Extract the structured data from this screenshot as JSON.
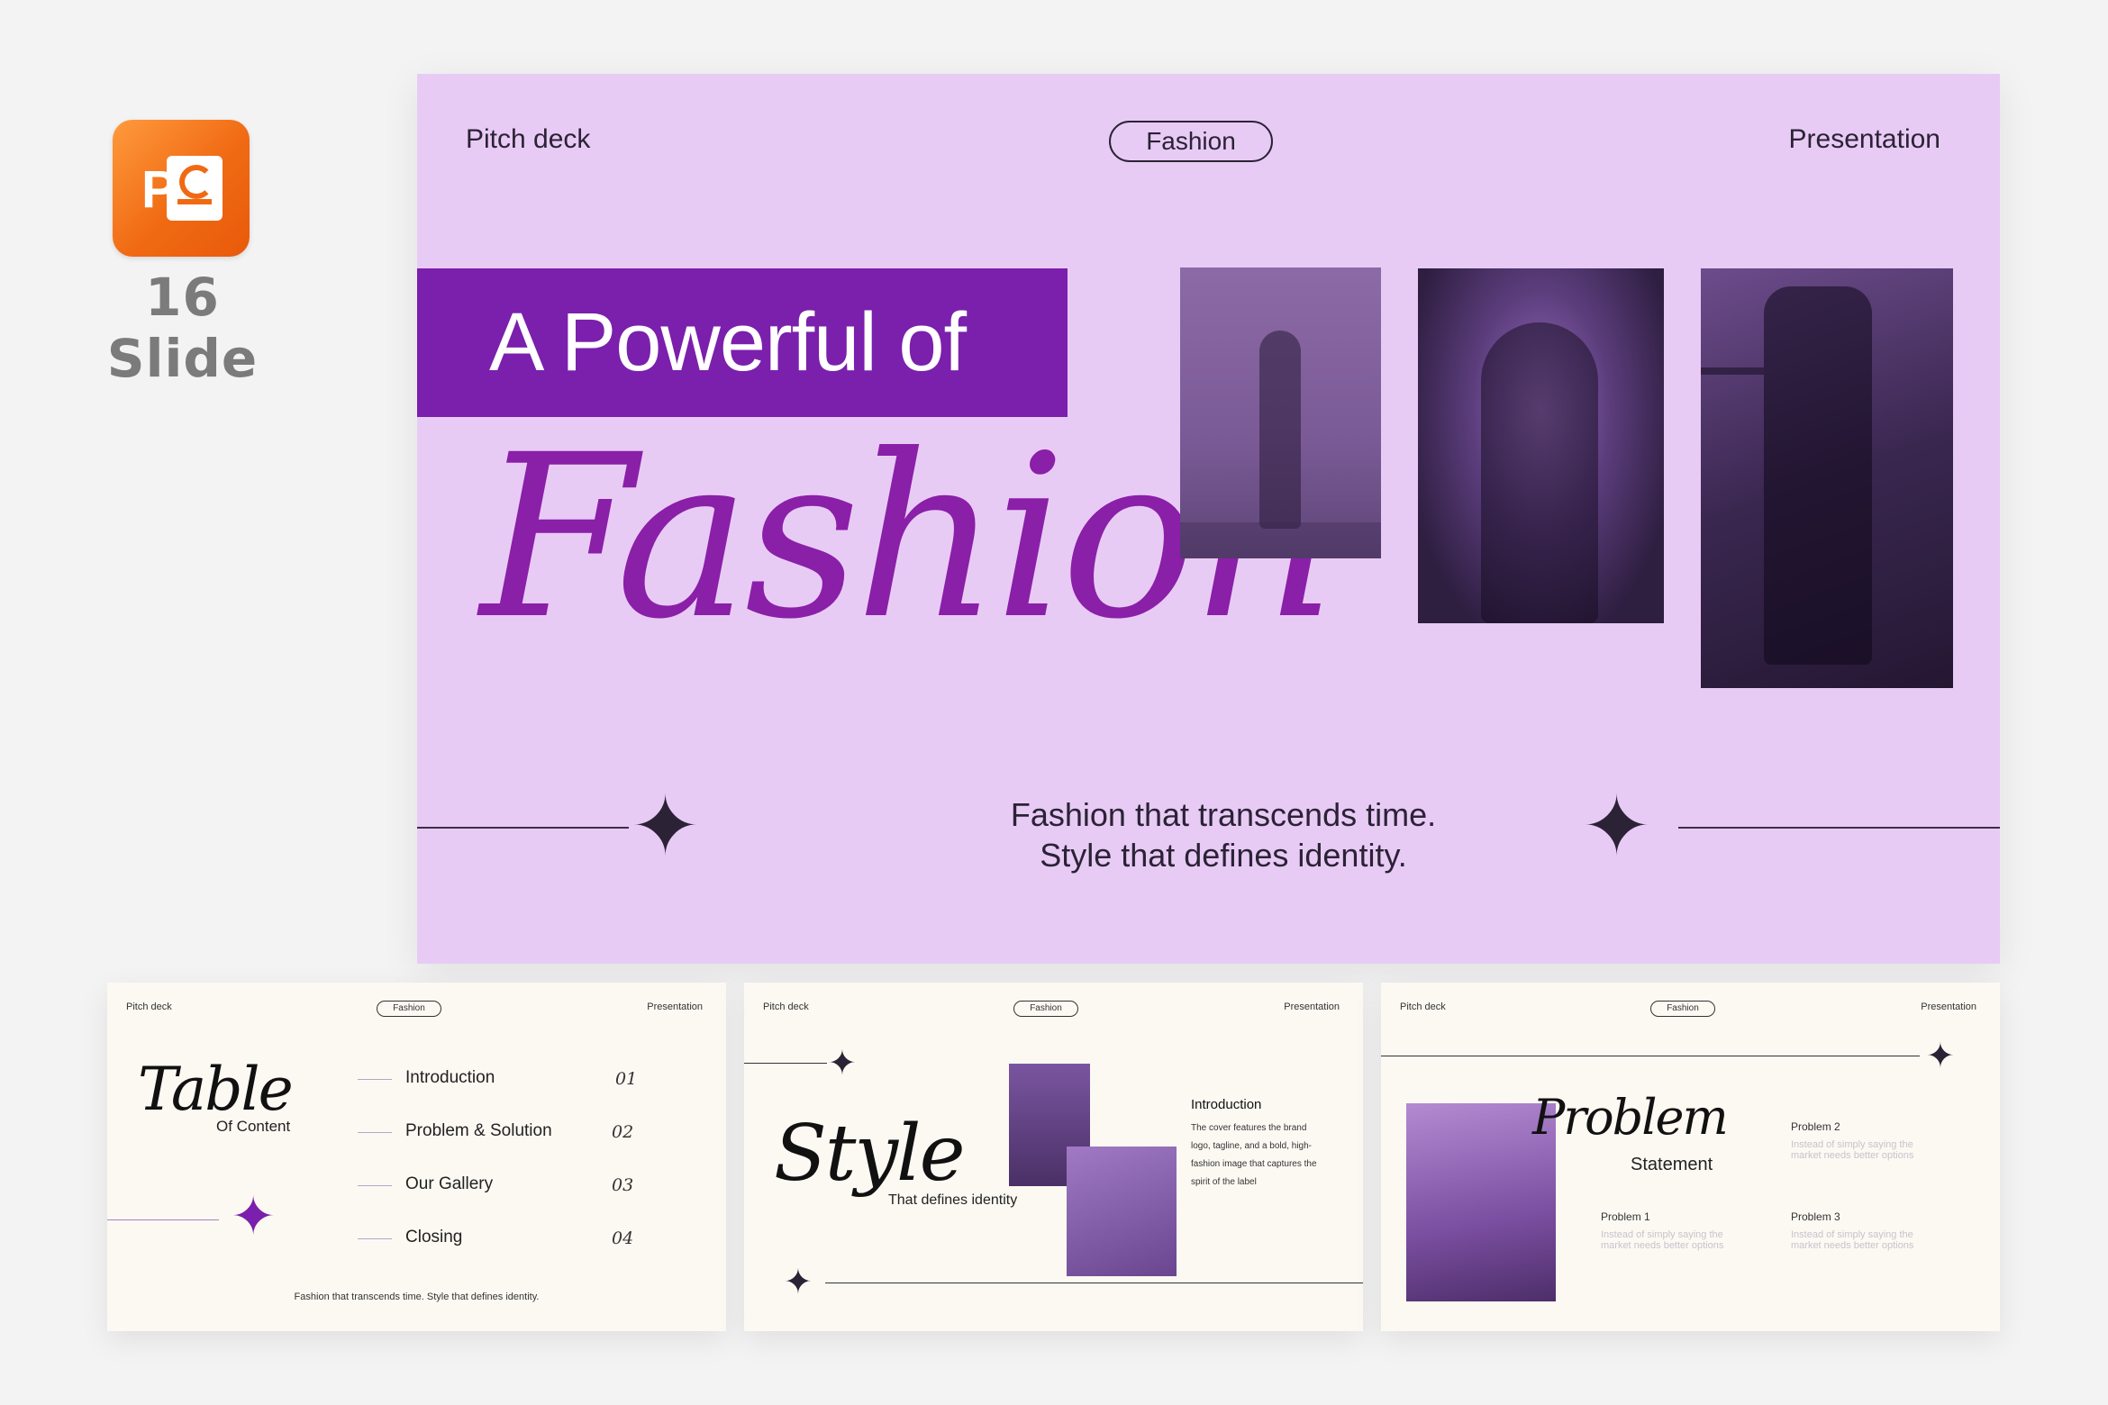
{
  "badge": {
    "icon": "powerpoint-icon",
    "icon_letter": "P",
    "slide_count": "16 Slide"
  },
  "main_slide": {
    "top_left": "Pitch deck",
    "top_pill": "Fashion",
    "top_right": "Presentation",
    "title": "A Powerful of",
    "script_title": "Fashion",
    "tagline_line1": "Fashion that transcends time.",
    "tagline_line2": "Style that defines identity."
  },
  "toc_slide": {
    "top_left": "Pitch deck",
    "top_pill": "Fashion",
    "top_right": "Presentation",
    "script_title": "Table",
    "subtitle": "Of Content",
    "items": [
      {
        "label": "Introduction",
        "num": "01"
      },
      {
        "label": "Problem & Solution",
        "num": "02"
      },
      {
        "label": "Our Gallery",
        "num": "03"
      },
      {
        "label": "Closing",
        "num": "04"
      }
    ],
    "footer": "Fashion that transcends time. Style that defines identity."
  },
  "style_slide": {
    "top_left": "Pitch deck",
    "top_pill": "Fashion",
    "top_right": "Presentation",
    "script_title": "Style",
    "subtitle": "That defines identity",
    "heading": "Introduction",
    "body_lines": [
      "The cover features the brand",
      "logo, tagline, and a bold, high-",
      "fashion image that captures the",
      "spirit of the label"
    ]
  },
  "problem_slide": {
    "top_left": "Pitch deck",
    "top_pill": "Fashion",
    "top_right": "Presentation",
    "script_title": "Problem",
    "subtitle": "Statement",
    "problems": [
      {
        "title": "Problem 2",
        "line1": "Instead of simply saying the",
        "line2": "market needs better options"
      },
      {
        "title": "Problem 1",
        "line1": "Instead of simply saying the",
        "line2": "market needs better options"
      },
      {
        "title": "Problem 3",
        "line1": "Instead of simply saying the",
        "line2": "market needs better options"
      }
    ]
  },
  "colors": {
    "slide_bg": "#e8cbf5",
    "accent": "#7b1fad",
    "script": "#8a1fa8",
    "mini_bg": "#fcf9f3",
    "ppt_orange": "#f06a13"
  }
}
